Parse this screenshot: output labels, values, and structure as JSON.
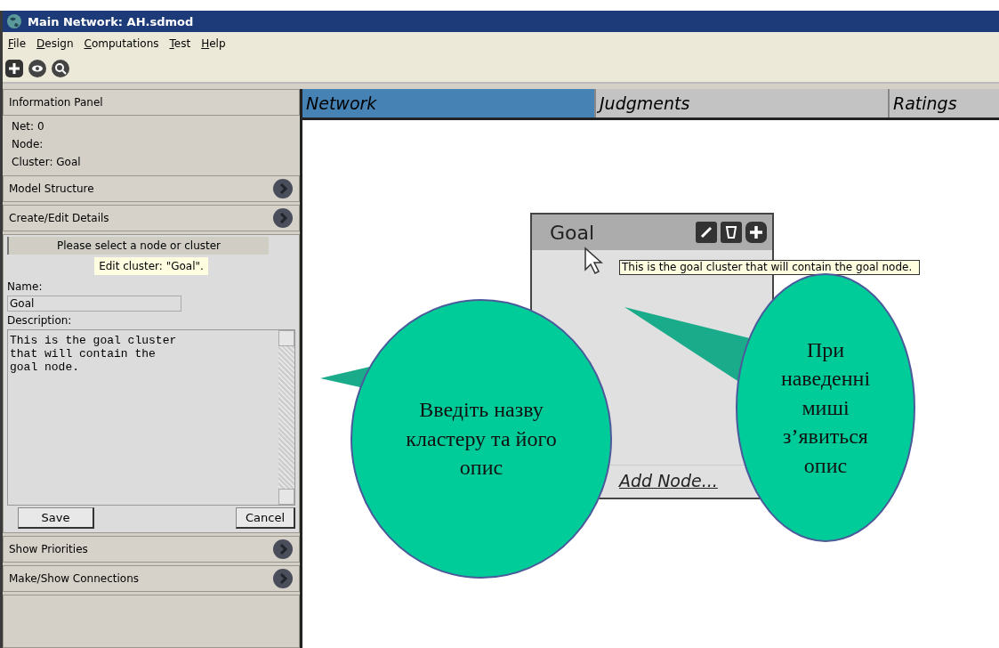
{
  "window": {
    "title": "Main Network: AH.sdmod"
  },
  "menu": [
    "File",
    "Design",
    "Computations",
    "Test",
    "Help"
  ],
  "sidebar": {
    "info_panel": {
      "title": "Information Panel",
      "lines": [
        "Net: 0",
        "Node:",
        "Cluster: Goal"
      ]
    },
    "sections_top": [
      "Model Structure",
      "Create/Edit Details"
    ],
    "editor": {
      "status": "Please select a node or cluster",
      "hint": "Edit cluster: \"Goal\".",
      "name_label": "Name:",
      "name_value": "Goal",
      "description_label": "Description:",
      "description_value": "This is the goal cluster\nthat will contain the\ngoal node.",
      "buttons": [
        "Save",
        "Cancel"
      ]
    },
    "sections_bottom": [
      "Show Priorities",
      "Make/Show Connections"
    ]
  },
  "tabs": [
    {
      "label": "Network",
      "selected": true
    },
    {
      "label": "Judgments",
      "selected": false
    },
    {
      "label": "Ratings",
      "selected": false
    }
  ],
  "cluster": {
    "title": "Goal",
    "tooltip": "This is the goal cluster that will contain the goal node.",
    "add_node": "Add Node..."
  },
  "callouts": [
    {
      "text": "Введіть назву кластеру та його опис"
    },
    {
      "text": "При наведенні миші з’явиться опис"
    }
  ]
}
